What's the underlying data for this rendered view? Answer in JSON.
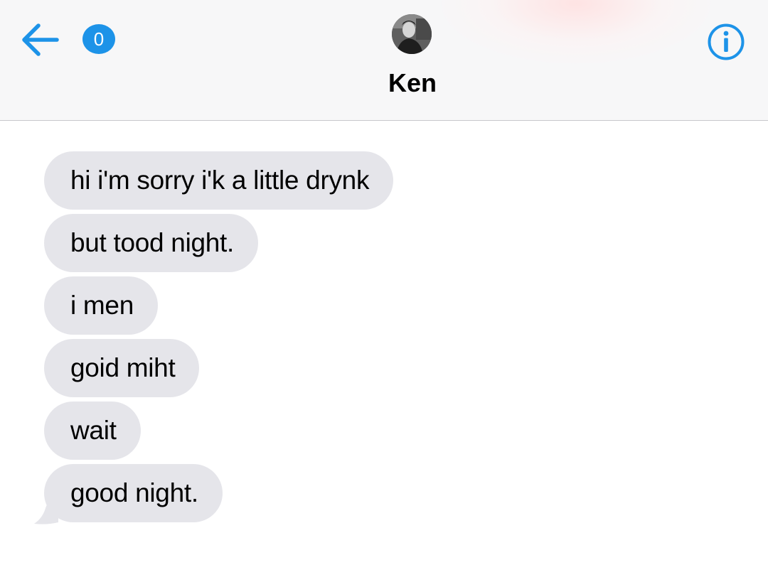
{
  "header": {
    "back_icon": "arrow-left-icon",
    "unread_count": "0",
    "contact_name": "Ken",
    "info_icon": "info-circle-icon",
    "accent_color": "#1d93e8"
  },
  "messages": [
    {
      "text": "hi i'm sorry i'k a little drynk",
      "sender": "incoming"
    },
    {
      "text": "but tood night.",
      "sender": "incoming"
    },
    {
      "text": "i men",
      "sender": "incoming"
    },
    {
      "text": "goid miht",
      "sender": "incoming"
    },
    {
      "text": "wait",
      "sender": "incoming"
    },
    {
      "text": "good night.",
      "sender": "incoming"
    }
  ],
  "colors": {
    "incoming_bubble": "#e5e5ea",
    "header_background": "#f7f7f8"
  }
}
